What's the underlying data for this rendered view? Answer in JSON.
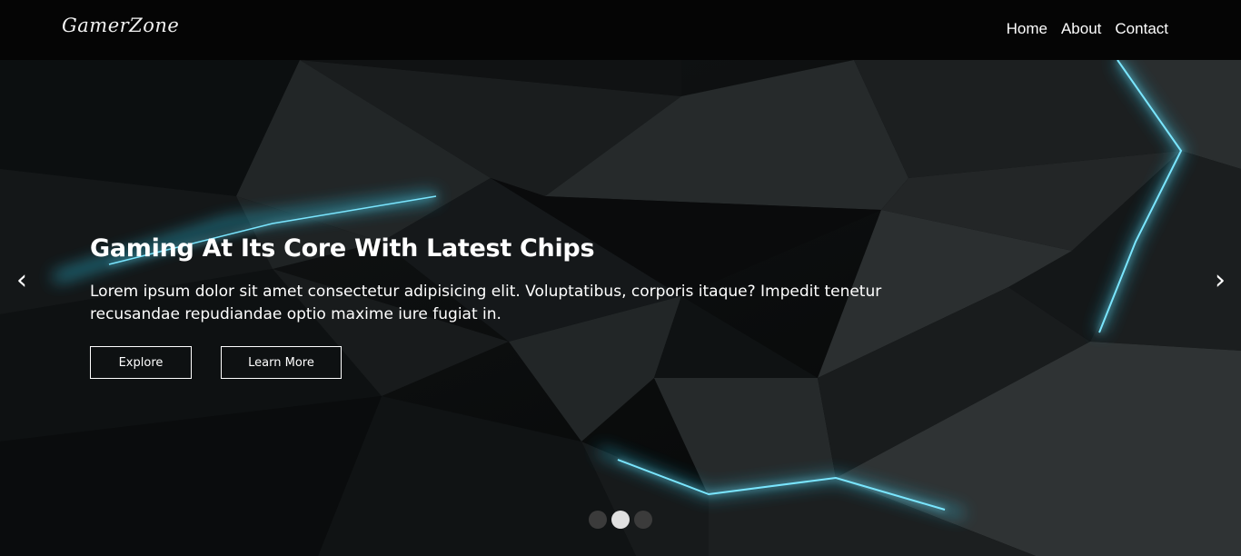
{
  "navbar": {
    "brand": "GamerZone",
    "links": [
      {
        "label": "Home"
      },
      {
        "label": "About"
      },
      {
        "label": "Contact"
      }
    ]
  },
  "hero": {
    "title": "Gaming At Its Core With Latest Chips",
    "description": "Lorem ipsum dolor sit amet consectetur adipisicing elit. Voluptatibus, corporis itaque? Impedit tenetur recusandae repudiandae optio maxime iure fugiat in.",
    "buttons": {
      "explore": "Explore",
      "learn_more": "Learn More"
    },
    "prev_arrow": "‹",
    "next_arrow": "›",
    "indicators": {
      "count": 3,
      "active_index": 1
    },
    "accent_color": "#2ec9ea"
  },
  "icons": [
    "chevron-left-icon",
    "chevron-right-icon"
  ]
}
